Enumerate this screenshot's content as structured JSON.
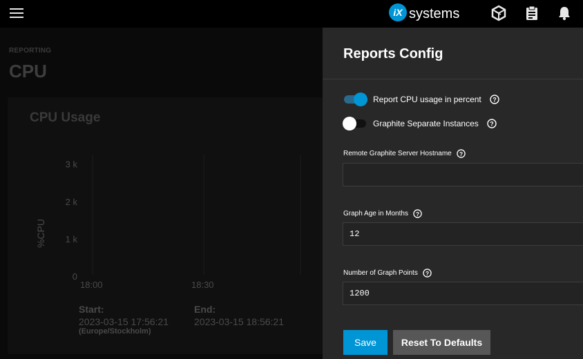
{
  "topbar": {
    "brand_prefix": "iX",
    "brand_name": "systems",
    "icons": [
      "menu-icon",
      "truecommand-icon",
      "clipboard-icon",
      "bell-icon"
    ]
  },
  "page": {
    "breadcrumb": "REPORTING",
    "title": "CPU"
  },
  "chart": {
    "title": "CPU Usage",
    "ylabel": "%CPU",
    "start_label": "Start:",
    "start_value": "2023-03-15 17:56:21",
    "timezone": "(Europe/Stockholm)",
    "end_label": "End:",
    "end_value": "2023-03-15 18:56:21"
  },
  "chart_data": {
    "type": "line",
    "title": "CPU Usage",
    "xlabel": "",
    "ylabel": "%CPU",
    "x_ticks": [
      "18:00",
      "18:30"
    ],
    "y_ticks": [
      "0",
      "1 k",
      "2 k",
      "3 k"
    ],
    "ylim": [
      0,
      3400
    ],
    "series": [],
    "grid": true
  },
  "panel": {
    "title": "Reports Config",
    "toggles": [
      {
        "label": "Report CPU usage in percent",
        "on": true
      },
      {
        "label": "Graphite Separate Instances",
        "on": false
      }
    ],
    "fields": {
      "hostname": {
        "label": "Remote Graphite Server Hostname",
        "value": ""
      },
      "graph_age": {
        "label": "Graph Age in Months",
        "value": "12"
      },
      "graph_points": {
        "label": "Number of Graph Points",
        "value": "1200"
      }
    },
    "buttons": {
      "save": "Save",
      "reset": "Reset To Defaults"
    }
  },
  "colors": {
    "accent": "#0095d5",
    "panel_bg": "#282828",
    "topbar_bg": "#000000"
  }
}
